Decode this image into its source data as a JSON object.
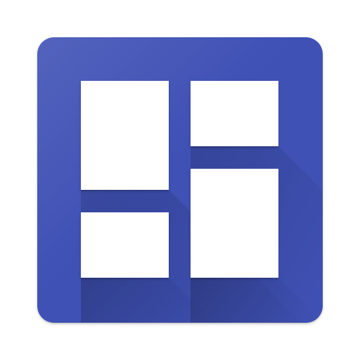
{
  "icon": {
    "name": "dashboard-grid-icon",
    "colors": {
      "background": "#3f51b5",
      "tile": "#ffffff",
      "shadow": "#2f3f8f"
    }
  }
}
